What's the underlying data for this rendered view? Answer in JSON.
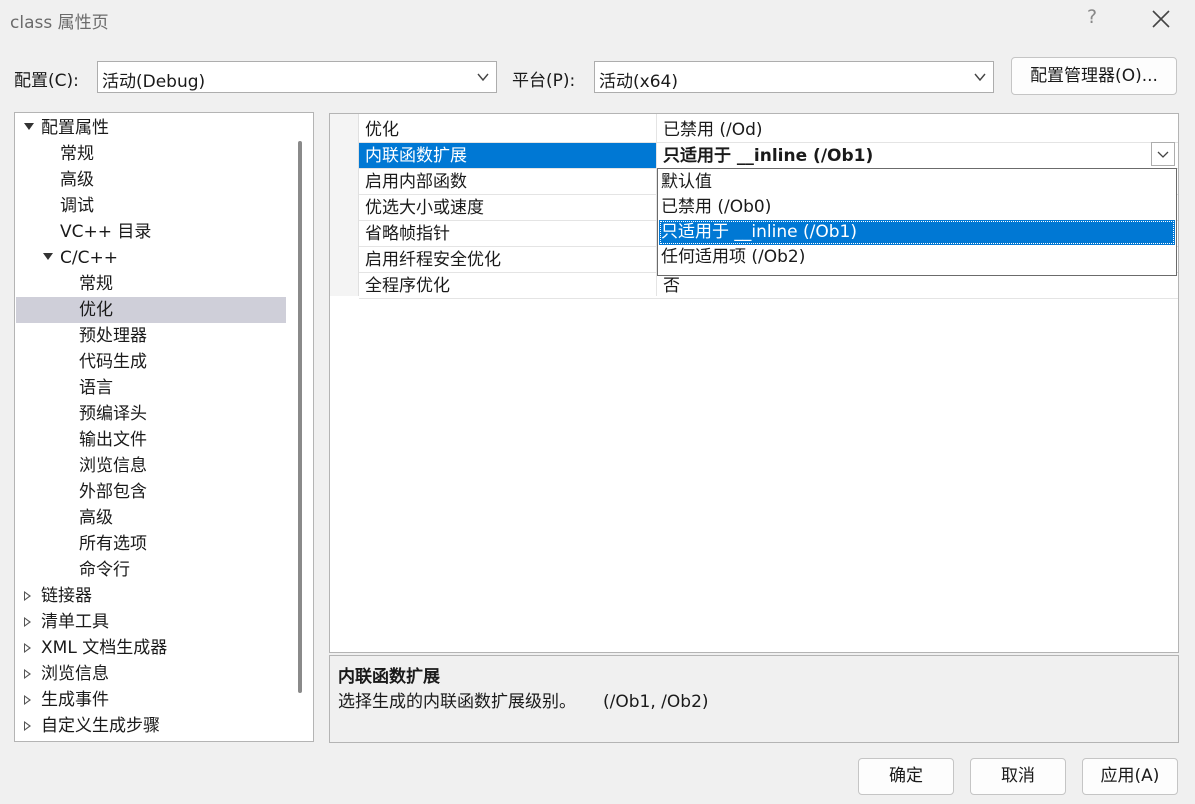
{
  "window": {
    "title": "class 属性页",
    "help_label": "?"
  },
  "config": {
    "label": "配置(C):",
    "value": "活动(Debug)"
  },
  "platform": {
    "label": "平台(P):",
    "value": "活动(x64)"
  },
  "config_manager_label": "配置管理器(O)...",
  "tree": [
    {
      "label": "配置属性",
      "state": "expanded"
    },
    {
      "label": "常规"
    },
    {
      "label": "高级"
    },
    {
      "label": "调试"
    },
    {
      "label": "VC++ 目录"
    },
    {
      "label": "C/C++",
      "state": "expanded"
    },
    {
      "label": "常规"
    },
    {
      "label": "优化",
      "selected": true
    },
    {
      "label": "预处理器"
    },
    {
      "label": "代码生成"
    },
    {
      "label": "语言"
    },
    {
      "label": "预编译头"
    },
    {
      "label": "输出文件"
    },
    {
      "label": "浏览信息"
    },
    {
      "label": "外部包含"
    },
    {
      "label": "高级"
    },
    {
      "label": "所有选项"
    },
    {
      "label": "命令行"
    },
    {
      "label": "链接器",
      "state": "collapsed"
    },
    {
      "label": "清单工具",
      "state": "collapsed"
    },
    {
      "label": "XML 文档生成器",
      "state": "collapsed"
    },
    {
      "label": "浏览信息",
      "state": "collapsed"
    },
    {
      "label": "生成事件",
      "state": "collapsed"
    },
    {
      "label": "自定义生成步骤",
      "state": "collapsed"
    }
  ],
  "properties": [
    {
      "name": "优化",
      "value": "已禁用 (/Od)"
    },
    {
      "name": "内联函数扩展",
      "value": "只适用于 __inline (/Ob1)",
      "selected": true
    },
    {
      "name": "启用内部函数",
      "value": ""
    },
    {
      "name": "优选大小或速度",
      "value": ""
    },
    {
      "name": "省略帧指针",
      "value": ""
    },
    {
      "name": "启用纤程安全优化",
      "value": ""
    },
    {
      "name": "全程序优化",
      "value": "否"
    }
  ],
  "dropdown_options": [
    {
      "label": "默认值"
    },
    {
      "label": "已禁用 (/Ob0)"
    },
    {
      "label": "只适用于 __inline (/Ob1)",
      "selected": true
    },
    {
      "label": "任何适用项 (/Ob2)"
    }
  ],
  "description": {
    "title": "内联函数扩展",
    "text": "选择生成的内联函数扩展级别。     (/Ob1, /Ob2)"
  },
  "buttons": {
    "ok": "确定",
    "cancel": "取消",
    "apply": "应用(A)"
  }
}
